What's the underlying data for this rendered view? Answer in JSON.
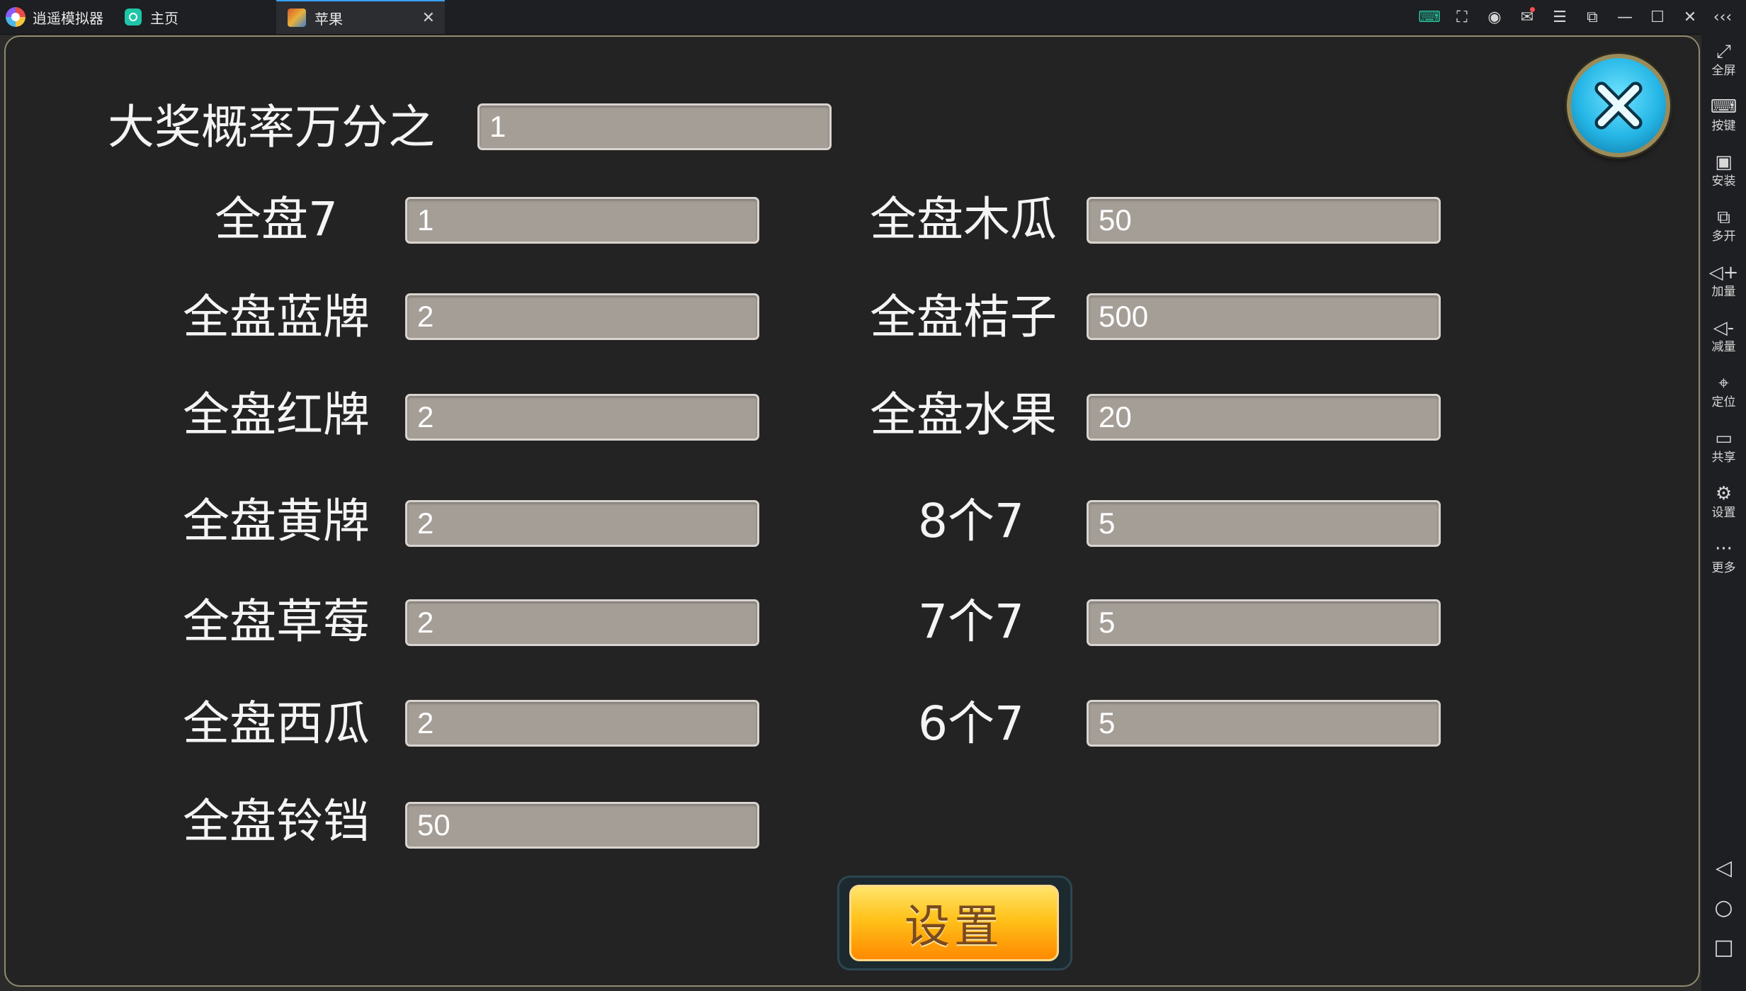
{
  "window": {
    "app_name": "逍遥模拟器",
    "tabs": [
      {
        "label": "主页"
      },
      {
        "label": "苹果"
      }
    ],
    "tab_close": "✕",
    "controls": {
      "keyboard": "⌨",
      "screenshot": "⛶",
      "account": "◉",
      "mail": "✉",
      "menu": "☰",
      "sync": "⧉",
      "minimize": "—",
      "maximize": "☐",
      "close": "✕",
      "collapse": "‹‹‹"
    }
  },
  "form": {
    "jackpot": {
      "label": "大奖概率万分之",
      "value": "1"
    },
    "left": [
      {
        "label": "全盘7",
        "value": "1"
      },
      {
        "label": "全盘蓝牌",
        "value": "2"
      },
      {
        "label": "全盘红牌",
        "value": "2"
      },
      {
        "label": "全盘黄牌",
        "value": "2"
      },
      {
        "label": "全盘草莓",
        "value": "2"
      },
      {
        "label": "全盘西瓜",
        "value": "2"
      },
      {
        "label": "全盘铃铛",
        "value": "50"
      }
    ],
    "right": [
      {
        "label": "全盘木瓜",
        "value": "50"
      },
      {
        "label": "全盘桔子",
        "value": "500"
      },
      {
        "label": "全盘水果",
        "value": "20"
      },
      {
        "label": "8个7",
        "value": "5"
      },
      {
        "label": "7个7",
        "value": "5"
      },
      {
        "label": "6个7",
        "value": "5"
      }
    ],
    "submit_label": "设置"
  },
  "sidebar": {
    "items": [
      {
        "icon": "⤢",
        "label": "全屏"
      },
      {
        "icon": "⌨",
        "label": "按键"
      },
      {
        "icon": "▣",
        "label": "安装"
      },
      {
        "icon": "⧉",
        "label": "多开"
      },
      {
        "icon": "◁+",
        "label": "加量"
      },
      {
        "icon": "◁-",
        "label": "减量"
      },
      {
        "icon": "⌖",
        "label": "定位"
      },
      {
        "icon": "▭",
        "label": "共享"
      },
      {
        "icon": "⚙",
        "label": "设置"
      },
      {
        "icon": "···",
        "label": "更多"
      }
    ],
    "nav": {
      "back": "◁",
      "home": "○",
      "recent": "□"
    }
  }
}
